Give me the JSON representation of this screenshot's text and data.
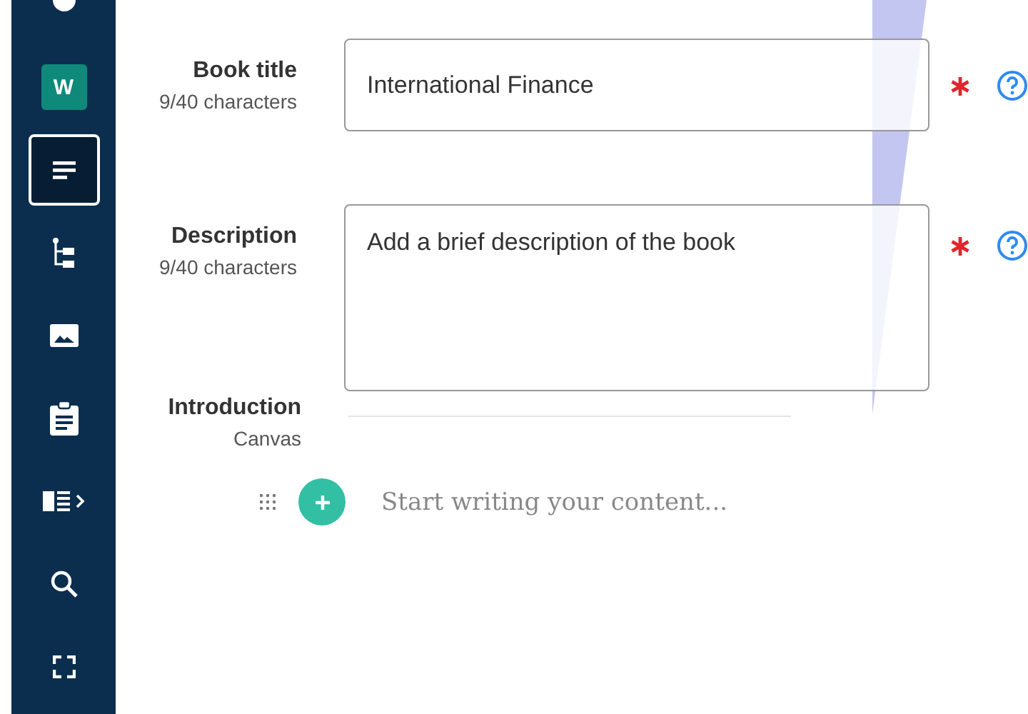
{
  "sidebar": {
    "items": [
      {
        "kind": "top",
        "selected": false
      },
      {
        "kind": "badge",
        "label": "W",
        "selected": false
      },
      {
        "kind": "text",
        "selected": true
      },
      {
        "kind": "tree",
        "selected": false
      },
      {
        "kind": "image",
        "selected": false
      },
      {
        "kind": "clipboard",
        "selected": false
      },
      {
        "kind": "panel",
        "selected": false
      },
      {
        "kind": "search",
        "selected": false
      },
      {
        "kind": "fullscreen",
        "selected": false
      }
    ]
  },
  "fields": [
    {
      "kind": "input",
      "label": "Book title",
      "count": "9/40 characters",
      "value": "International Finance",
      "required": true,
      "help": true
    },
    {
      "kind": "textarea",
      "label": "Description",
      "count": "9/40 characters",
      "placeholder": "Add a brief description of the book",
      "required": true,
      "help": true
    }
  ],
  "section": {
    "title": "Introduction",
    "subtitle": "Canvas"
  },
  "editor": {
    "placeholder": "Start writing your content..."
  }
}
